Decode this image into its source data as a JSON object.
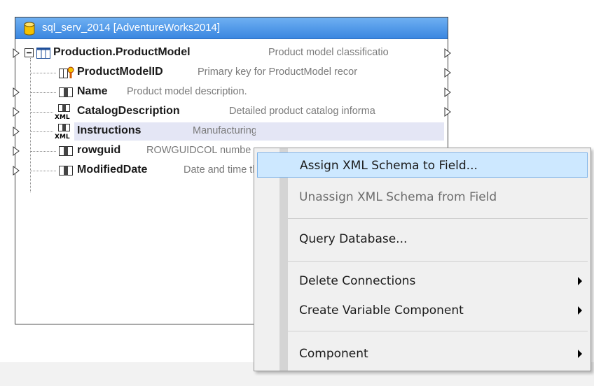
{
  "component": {
    "title": "sql_serv_2014 [AdventureWorks2014]",
    "table": {
      "name": "Production.ProductModel",
      "description": "Product model classificatio"
    },
    "fields": [
      {
        "name": "ProductModelID",
        "description": "Primary key for ProductModel recor",
        "icon": "primary-key-icon"
      },
      {
        "name": "Name",
        "description": "Product model description.",
        "icon": "column-icon"
      },
      {
        "name": "CatalogDescription",
        "description": "Detailed product catalog informa",
        "icon": "xml-column-icon"
      },
      {
        "name": "Instructions",
        "description": "Manufacturing instructions in xml fo",
        "icon": "xml-column-icon"
      },
      {
        "name": "rowguid",
        "description": "ROWGUIDCOL number uniquely ide",
        "icon": "column-icon"
      },
      {
        "name": "ModifiedDate",
        "description": "Date and time the record was last up",
        "icon": "column-icon"
      }
    ]
  },
  "context_menu": {
    "items": [
      {
        "label": "Assign XML Schema to Field...",
        "state": "selected"
      },
      {
        "label": "Unassign XML Schema from Field",
        "state": "disabled"
      },
      {
        "label": "Query Database..."
      },
      {
        "label": "Delete Connections",
        "submenu": true
      },
      {
        "label": "Create Variable Component",
        "submenu": true
      },
      {
        "label": "Component",
        "submenu": true
      }
    ]
  },
  "colors": {
    "header_gradient_top": "#6fb0f2",
    "header_gradient_bottom": "#3a86e0",
    "menu_selected_bg": "#cde8ff",
    "row_highlight": "#e4e6f5"
  }
}
